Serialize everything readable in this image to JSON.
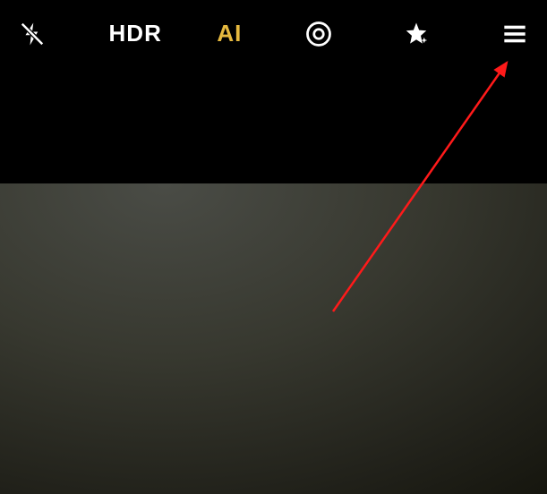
{
  "toolbar": {
    "flash": {
      "name": "flash-off-icon"
    },
    "hdr": {
      "label": "HDR"
    },
    "ai": {
      "label": "AI"
    },
    "motion": {
      "name": "motion-photo-icon"
    },
    "effects": {
      "name": "magic-star-icon"
    },
    "menu": {
      "name": "hamburger-menu-icon"
    }
  },
  "annotation": {
    "arrow_color": "#ff1a1a"
  }
}
